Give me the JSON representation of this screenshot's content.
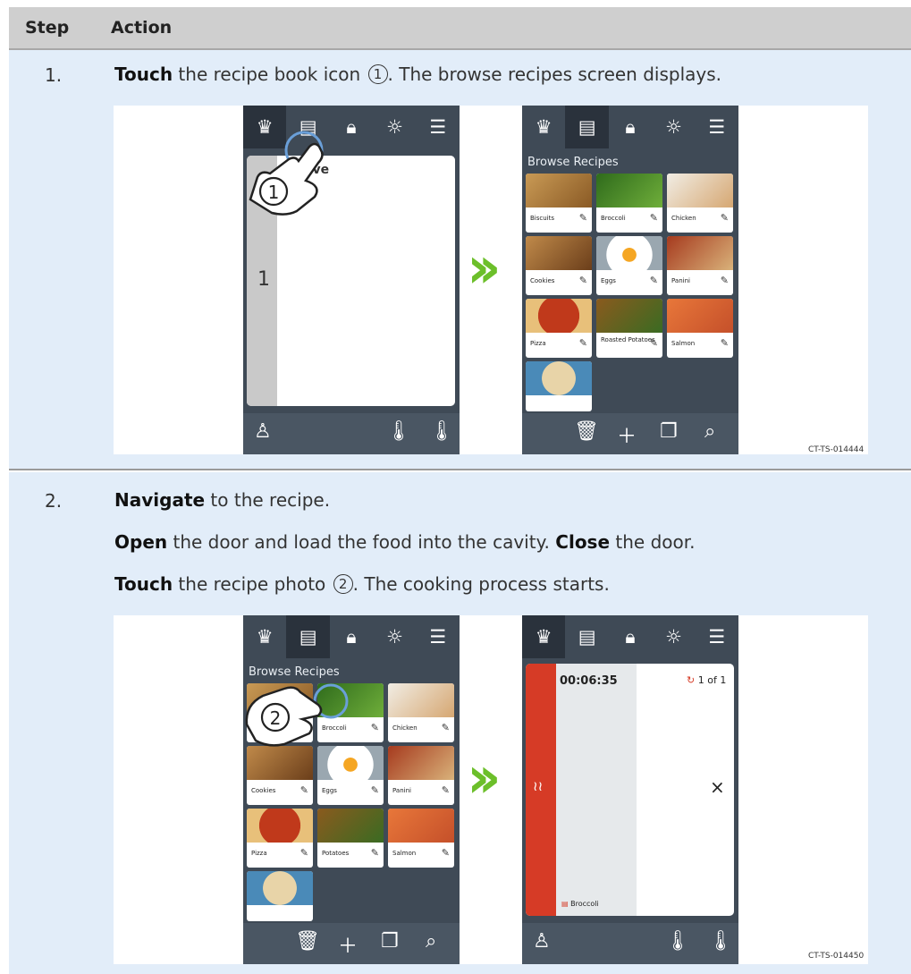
{
  "header": {
    "step": "Step",
    "action": "Action"
  },
  "step1": {
    "number": "1.",
    "bold": "Touch",
    "text_a": " the recipe book icon ",
    "callout": "1",
    "text_b": ". The browse recipes screen displays.",
    "figure_code": "CT-TS-014444",
    "left_screen": {
      "partial_label": "tive",
      "side_number": "1"
    },
    "right_screen": {
      "title": "Browse Recipes"
    }
  },
  "step2": {
    "number": "2.",
    "line1_bold": "Navigate",
    "line1_text": " to the recipe.",
    "line2_bold1": "Open",
    "line2_text1": " the door and load the food into the cavity. ",
    "line2_bold2": "Close",
    "line2_text2": " the door.",
    "line3_bold": "Touch",
    "line3_text_a": " the recipe photo ",
    "callout": "2",
    "line3_text_b": ". The cooking process starts.",
    "figure_code": "CT-TS-014450",
    "left_screen": {
      "title": "Browse Recipes"
    },
    "right_screen": {
      "timer": "00:06:35",
      "count": "1 of 1",
      "recipe": "Broccoli",
      "close": "×"
    }
  },
  "recipes": [
    "Biscuits",
    "Broccoli",
    "Chicken",
    "Cookies",
    "Eggs",
    "Panini",
    "Pizza",
    "Roasted Potatoes",
    "Salmon"
  ],
  "recipes_step2": [
    "Broccoli",
    "Chicken",
    "Cookies",
    "Eggs",
    "Panini",
    "Pizza",
    "Potatoes",
    "Salmon"
  ],
  "icons": [
    "chef-hat-icon",
    "recipe-book-icon",
    "lock-icon",
    "brightness-icon",
    "menu-icon",
    "user-icon",
    "probe-temp-icon",
    "temperature-icon",
    "trash-icon",
    "plus-icon",
    "copy-icon",
    "search-icon"
  ],
  "colors": {
    "toolbar": "#3f4a56",
    "toolbar_selected": "#2a323c",
    "chevron": "#6cbf2a",
    "cook_bar": "#d63b26",
    "row_bg": "#e2edf9",
    "header_bg": "#cfcfcf"
  }
}
